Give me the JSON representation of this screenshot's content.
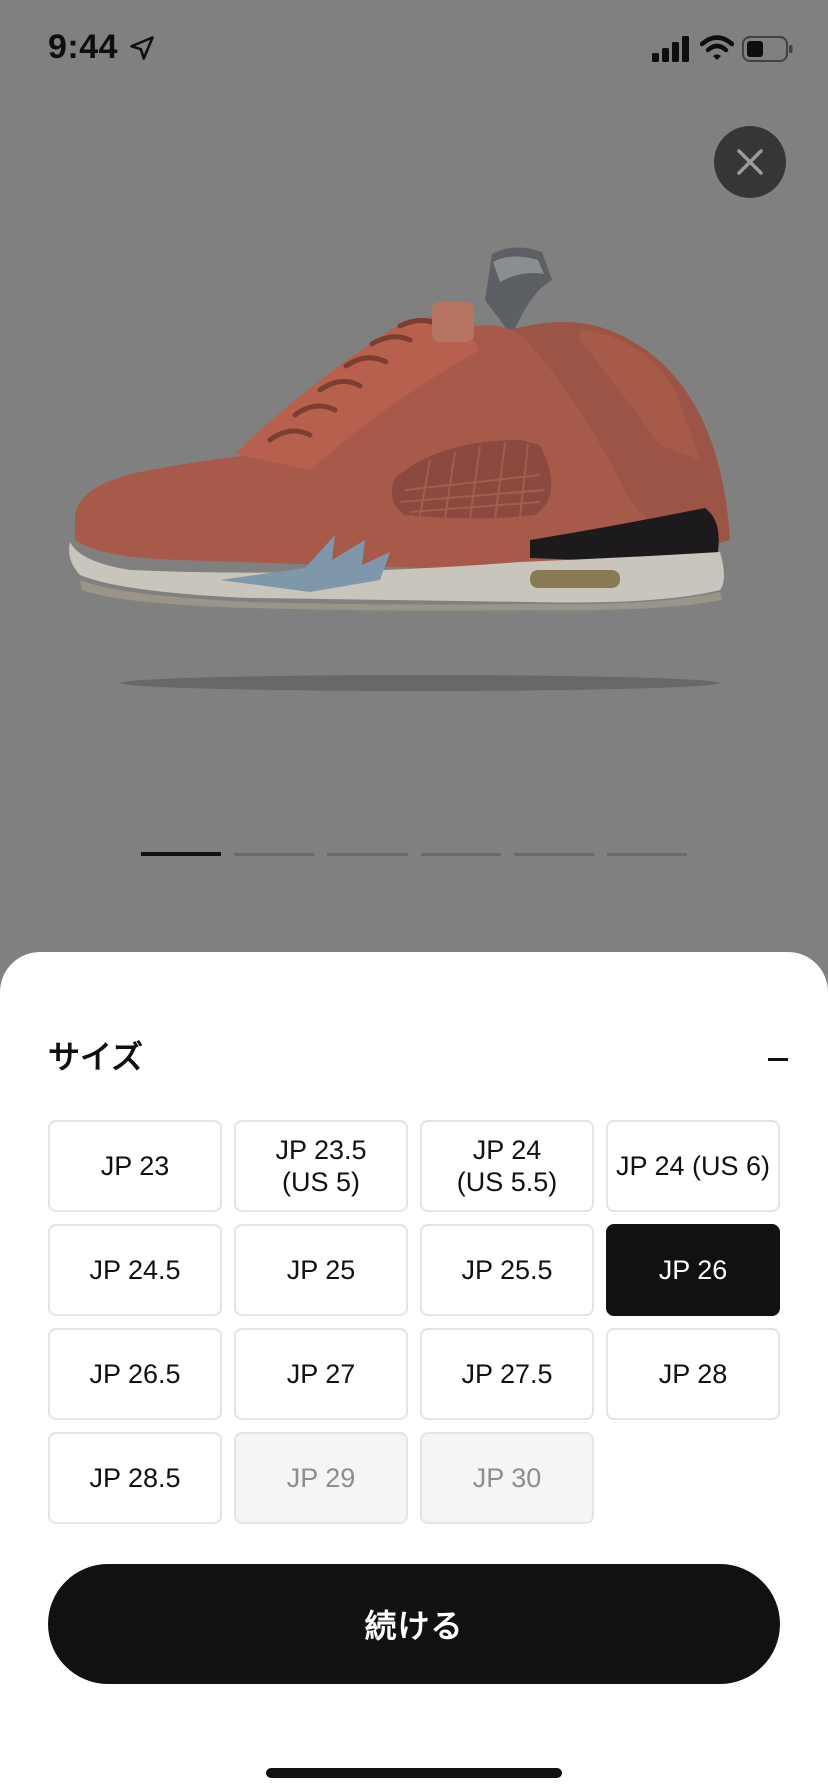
{
  "status_bar": {
    "time": "9:44",
    "icons": [
      "location-arrow-icon",
      "cellular-signal-icon",
      "wifi-icon",
      "battery-icon"
    ]
  },
  "product": {
    "image_icon": "sneaker-photo",
    "pager": {
      "count": 6,
      "active_index": 0
    }
  },
  "size_sheet": {
    "title": "サイズ",
    "collapse_icon": "minus-icon",
    "sizes": [
      {
        "label": "JP 23",
        "state": "available"
      },
      {
        "label": "JP 23.5\n(US 5)",
        "state": "available"
      },
      {
        "label": "JP 24\n(US 5.5)",
        "state": "available"
      },
      {
        "label": "JP 24 (US 6)",
        "state": "available"
      },
      {
        "label": "JP 24.5",
        "state": "available"
      },
      {
        "label": "JP 25",
        "state": "available"
      },
      {
        "label": "JP 25.5",
        "state": "available"
      },
      {
        "label": "JP 26",
        "state": "selected"
      },
      {
        "label": "JP 26.5",
        "state": "available"
      },
      {
        "label": "JP 27",
        "state": "available"
      },
      {
        "label": "JP 27.5",
        "state": "available"
      },
      {
        "label": "JP 28",
        "state": "available"
      },
      {
        "label": "JP 28.5",
        "state": "available"
      },
      {
        "label": "JP 29",
        "state": "disabled"
      },
      {
        "label": "JP 30",
        "state": "disabled"
      }
    ],
    "continue_label": "続ける"
  },
  "colors": {
    "overlay": "#808080",
    "primary": "#111111",
    "border": "#e4e4e4",
    "disabled_bg": "#f5f5f5",
    "disabled_text": "#8e8e8e"
  }
}
